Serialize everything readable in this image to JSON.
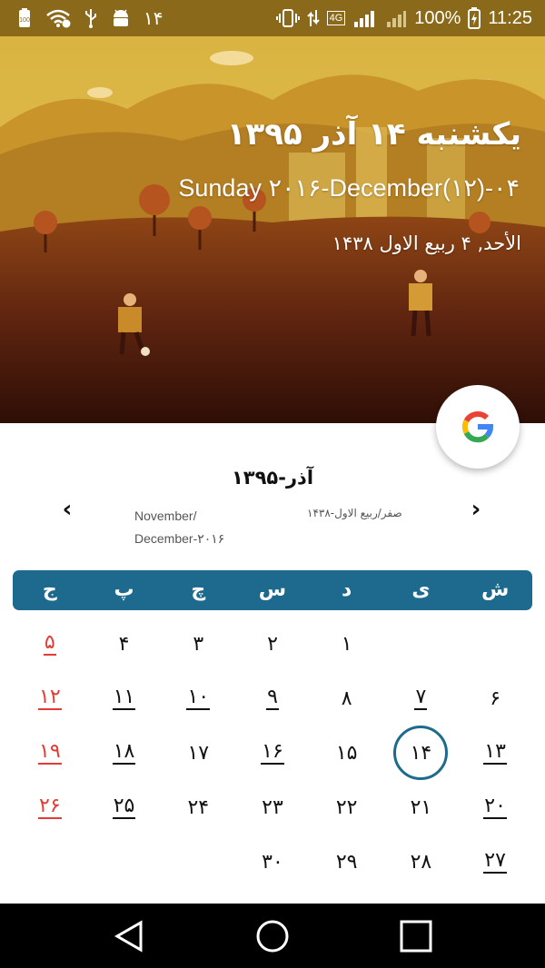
{
  "status_bar": {
    "left_icons": [
      "battery-saver-icon",
      "wifi-icon",
      "usb-icon",
      "android-icon"
    ],
    "notification_number": "۱۴",
    "battery_percent": "100%",
    "time": "11:25",
    "network_label": "4G"
  },
  "header": {
    "persian_date": "یکشنبه ۱۴ آذر ۱۳۹۵",
    "gregorian_date": "Sunday ۲۰۱۶-December(۱۲)-۰۴",
    "hijri_date": "الأحد, ۴ ربیع الاول ۱۴۳۸",
    "theme_colors": {
      "sky": "#e2b93a",
      "hills": "#c9952a",
      "ground": "#7a3412",
      "ground_dark": "#3d1208"
    }
  },
  "fab": {
    "icon": "google-icon"
  },
  "month_nav": {
    "title": "آذر-۱۳۹۵",
    "gregorian_range_line1": "November/",
    "gregorian_range_line2": "December-۲۰۱۶",
    "hijri_range": "صفر/ربیع الاول-۱۴۳۸"
  },
  "weekdays": [
    "ش",
    "ی",
    "د",
    "س",
    "چ",
    "پ",
    "ج"
  ],
  "weeks": [
    [
      {
        "n": ""
      },
      {
        "n": ""
      },
      {
        "n": "۱"
      },
      {
        "n": "۲"
      },
      {
        "n": "۳"
      },
      {
        "n": "۴"
      },
      {
        "n": "۵",
        "holiday": true,
        "ul": true
      }
    ],
    [
      {
        "n": "۶"
      },
      {
        "n": "۷",
        "ul": true
      },
      {
        "n": "۸"
      },
      {
        "n": "۹",
        "ul": true
      },
      {
        "n": "۱۰",
        "ul": true
      },
      {
        "n": "۱۱",
        "ul": true
      },
      {
        "n": "۱۲",
        "holiday": true,
        "ul": true
      }
    ],
    [
      {
        "n": "۱۳",
        "ul": true
      },
      {
        "n": "۱۴",
        "today": true
      },
      {
        "n": "۱۵"
      },
      {
        "n": "۱۶",
        "ul": true
      },
      {
        "n": "۱۷"
      },
      {
        "n": "۱۸",
        "ul": true
      },
      {
        "n": "۱۹",
        "holiday": true,
        "ul": true
      }
    ],
    [
      {
        "n": "۲۰",
        "ul": true
      },
      {
        "n": "۲۱"
      },
      {
        "n": "۲۲"
      },
      {
        "n": "۲۳"
      },
      {
        "n": "۲۴"
      },
      {
        "n": "۲۵",
        "ul": true
      },
      {
        "n": "۲۶",
        "holiday": true,
        "ul": true
      }
    ],
    [
      {
        "n": "۲۷",
        "ul": true
      },
      {
        "n": "۲۸"
      },
      {
        "n": "۲۹"
      },
      {
        "n": "۳۰"
      },
      {
        "n": ""
      },
      {
        "n": ""
      },
      {
        "n": ""
      }
    ]
  ],
  "colors": {
    "accent": "#1e6a8e",
    "holiday": "#e53935",
    "nav_bar": "#000000"
  },
  "nav_bar": [
    "back-icon",
    "home-icon",
    "recents-icon"
  ]
}
